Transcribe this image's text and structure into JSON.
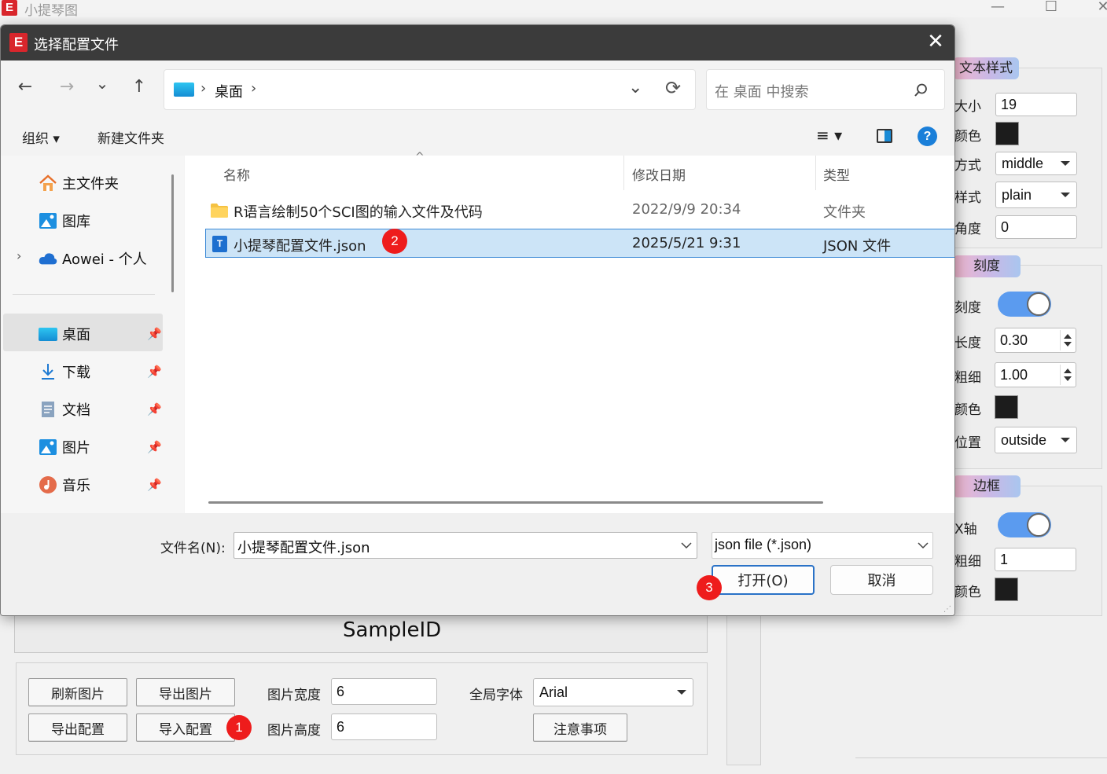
{
  "app": {
    "title": "小提琴图",
    "logo_letter": "E",
    "minimize_glyph": "—",
    "maximize_glyph": "☐",
    "close_glyph": "✕"
  },
  "right_panel": {
    "text_style": {
      "header": "文本样式",
      "size_label": "大小",
      "size_value": "19",
      "color_label": "颜色",
      "color_value": "#1c1c1c",
      "align_label": "方式",
      "align_value": "middle",
      "style_label": "样式",
      "style_value": "plain",
      "angle_label": "角度",
      "angle_value": "0"
    },
    "ticks": {
      "header": "刻度",
      "show_label": "刻度",
      "show_on": true,
      "length_label": "长度",
      "length_value": "0.30",
      "width_label": "粗细",
      "width_value": "1.00",
      "color_label": "颜色",
      "color_value": "#1c1c1c",
      "position_label": "位置",
      "position_value": "outside"
    },
    "border": {
      "header": "边框",
      "axis_label": "X轴",
      "axis_on": true,
      "width_label": "粗细",
      "width_value": "1",
      "color_label": "颜色",
      "color_value": "#1c1c1c"
    }
  },
  "plot": {
    "sample_label": "SampleID"
  },
  "bottom_bar": {
    "refresh": "刷新图片",
    "export_image": "导出图片",
    "export_config": "导出配置",
    "import_config": "导入配置",
    "width_label": "图片宽度",
    "width_value": "6",
    "height_label": "图片高度",
    "height_value": "6",
    "font_label": "全局字体",
    "font_value": "Arial",
    "notes": "注意事项"
  },
  "badges": {
    "b1": "1",
    "b2": "2",
    "b3": "3"
  },
  "dialog": {
    "title": "选择配置文件",
    "close": "✕",
    "nav": {
      "back": "←",
      "forward": "→",
      "recent": "⌄",
      "up": "↑"
    },
    "address": {
      "sep": "›",
      "location": "桌面",
      "refresh": "⟳",
      "dropdown": "⌄"
    },
    "search_placeholder": "在 桌面 中搜索",
    "toolbar": {
      "organize": "组织 ▾",
      "new_folder": "新建文件夹",
      "view": "≡ ▾",
      "help": "?"
    },
    "sidebar": {
      "home": "主文件夹",
      "gallery": "图库",
      "onedrive": "Aowei - 个人",
      "desktop": "桌面",
      "downloads": "下载",
      "documents": "文档",
      "pictures": "图片",
      "music": "音乐"
    },
    "columns": {
      "name": "名称",
      "date": "修改日期",
      "type": "类型"
    },
    "files": [
      {
        "name": "R语言绘制50个SCI图的输入文件及代码",
        "date": "2022/9/9 20:34",
        "type": "文件夹"
      },
      {
        "name": "小提琴配置文件.json",
        "date": "2025/5/21 9:31",
        "type": "JSON 文件"
      }
    ],
    "filename_label": "文件名(N):",
    "filename_value": "小提琴配置文件.json",
    "filter_value": "json file (*.json)",
    "open_button": "打开(O)",
    "cancel_button": "取消"
  }
}
